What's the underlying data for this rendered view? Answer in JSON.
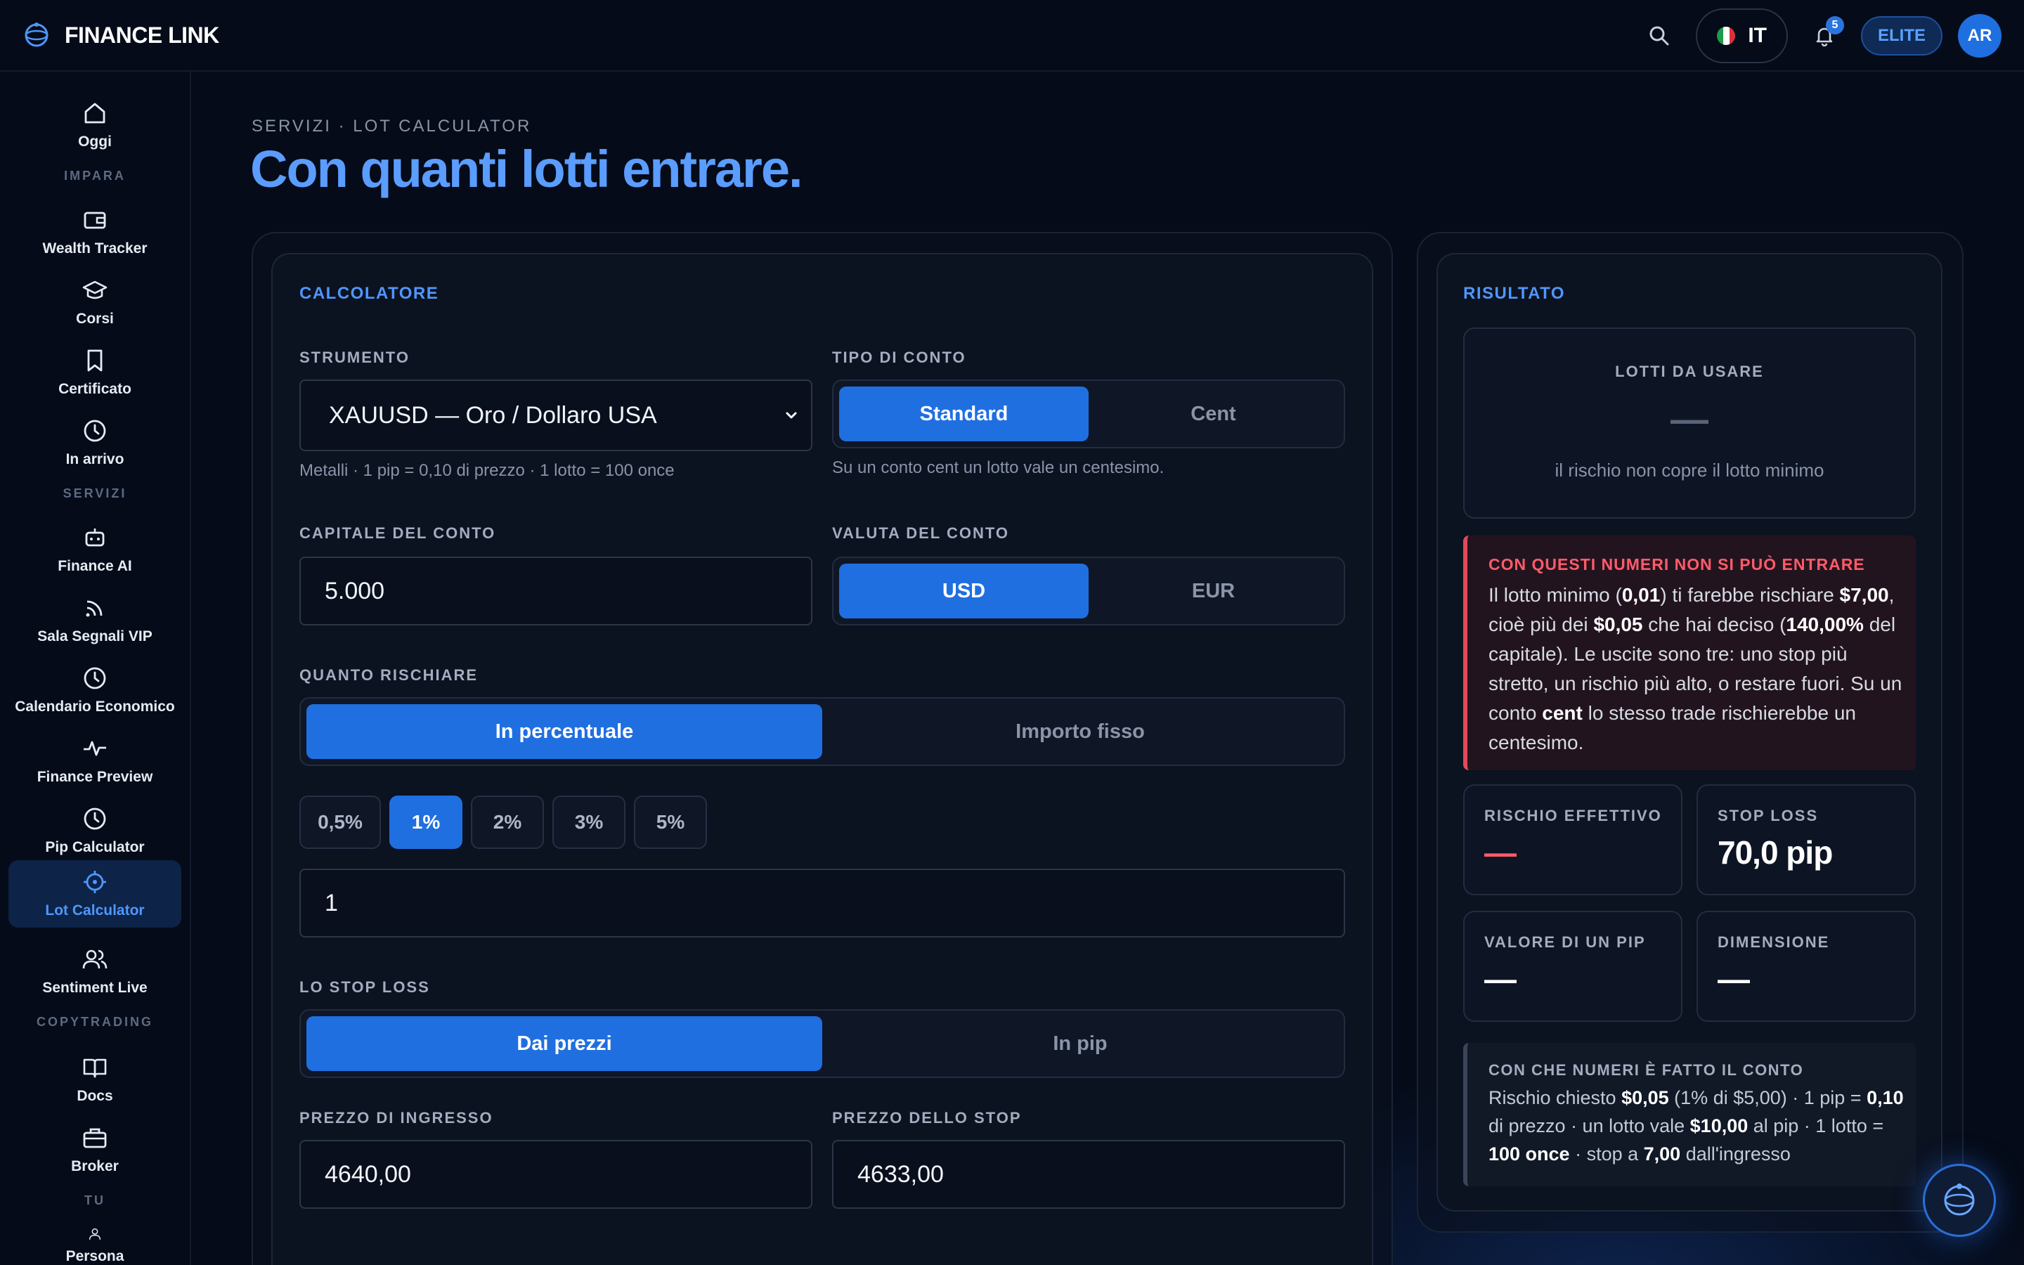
{
  "app": {
    "name": "FINANCE LINK"
  },
  "topbar": {
    "lang": "IT",
    "notifications": "5",
    "plan": "ELITE",
    "avatar_initials": "AR"
  },
  "sidebar": {
    "sections": {
      "impara": "IMPARA",
      "servizi": "SERVIZI",
      "copytrading": "COPYTRADING",
      "tu": "TU"
    },
    "items": [
      {
        "label": "Oggi",
        "icon": "home-icon"
      },
      {
        "label": "Wealth Tracker",
        "icon": "wallet-icon"
      },
      {
        "label": "Corsi",
        "icon": "graduation-cap-icon"
      },
      {
        "label": "Certificato",
        "icon": "bookmark-icon"
      },
      {
        "label": "In arrivo",
        "icon": "clock-icon"
      },
      {
        "label": "Finance AI",
        "icon": "robot-icon"
      },
      {
        "label": "Sala Segnali VIP",
        "icon": "signal-icon"
      },
      {
        "label": "Calendario Economico",
        "icon": "clock-icon"
      },
      {
        "label": "Finance Preview",
        "icon": "pulse-icon"
      },
      {
        "label": "Pip Calculator",
        "icon": "clock-icon"
      },
      {
        "label": "Lot Calculator",
        "icon": "crosshair-icon",
        "active": true
      },
      {
        "label": "Sentiment Live",
        "icon": "users-icon"
      },
      {
        "label": "Docs",
        "icon": "book-icon"
      },
      {
        "label": "Broker",
        "icon": "briefcase-icon"
      },
      {
        "label": "Persona",
        "icon": "user-icon"
      }
    ]
  },
  "page": {
    "breadcrumb": "SERVIZI · LOT CALCULATOR",
    "title": "Con quanti lotti entrare."
  },
  "calculator": {
    "title": "CALCOLATORE",
    "instrument": {
      "label": "STRUMENTO",
      "value": "XAUUSD — Oro / Dollaro USA",
      "hint": "Metalli · 1 pip = 0,10 di prezzo · 1 lotto = 100 once"
    },
    "account_type": {
      "label": "TIPO DI CONTO",
      "options": [
        "Standard",
        "Cent"
      ],
      "selected": "Standard",
      "hint": "Su un conto cent un lotto vale un centesimo."
    },
    "capital": {
      "label": "CAPITALE DEL CONTO",
      "value": "5.000"
    },
    "currency": {
      "label": "VALUTA DEL CONTO",
      "options": [
        "USD",
        "EUR"
      ],
      "selected": "USD"
    },
    "risk": {
      "label": "QUANTO RISCHIARE",
      "modes": [
        "In percentuale",
        "Importo fisso"
      ],
      "selected": "In percentuale",
      "chips": [
        "0,5%",
        "1%",
        "2%",
        "3%",
        "5%"
      ],
      "selected_chip": "1%",
      "value": "1"
    },
    "stop": {
      "label": "LO STOP LOSS",
      "modes": [
        "Dai prezzi",
        "In pip"
      ],
      "selected": "Dai prezzi"
    },
    "entry": {
      "label": "PREZZO DI INGRESSO",
      "value": "4640,00"
    },
    "stop_price": {
      "label": "PREZZO DELLO STOP",
      "value": "4633,00"
    }
  },
  "result": {
    "title": "RISULTATO",
    "lots_label": "LOTTI DA USARE",
    "lots_value": "—",
    "lots_note": "il rischio non copre il lotto minimo",
    "warning_title": "CON QUESTI NUMERI NON SI PUÒ ENTRARE",
    "warning": {
      "t1": "Il lotto minimo (",
      "b1": "0,01",
      "t2": ") ti farebbe rischiare ",
      "b2": "$7,00",
      "t3": ", cioè più dei ",
      "b3": "$0,05",
      "t4": " che hai deciso (",
      "b4": "140,00%",
      "t5": " del capitale). Le uscite sono tre: uno stop più stretto, un rischio più alto, o restare fuori. Su un conto ",
      "b5": "cent",
      "t6": " lo stesso trade rischierebbe un centesimo."
    },
    "effective_risk": {
      "label": "RISCHIO EFFETTIVO",
      "value": "—"
    },
    "stop_loss": {
      "label": "STOP LOSS",
      "value": "70,0 pip"
    },
    "pip_value": {
      "label": "VALORE DI UN PIP",
      "value": "—"
    },
    "size": {
      "label": "DIMENSIONE",
      "value": "—"
    },
    "info_title": "CON CHE NUMERI È FATTO IL CONTO",
    "info": {
      "t1": "Rischio chiesto ",
      "b1": "$0,05",
      "t2": " (1% di $5,00) · 1 pip = ",
      "b2": "0,10",
      "t3": " di prezzo · un lotto vale ",
      "b3": "$10,00",
      "t4": " al pip · 1 lotto = ",
      "b4": "100 once",
      "t5": " · stop a ",
      "b5": "7,00",
      "t6": " dall'ingresso"
    }
  },
  "colors": {
    "accent": "#1f6fe0",
    "title": "#5b9cff",
    "danger": "#ff5b6b",
    "bg": "#050b18"
  }
}
